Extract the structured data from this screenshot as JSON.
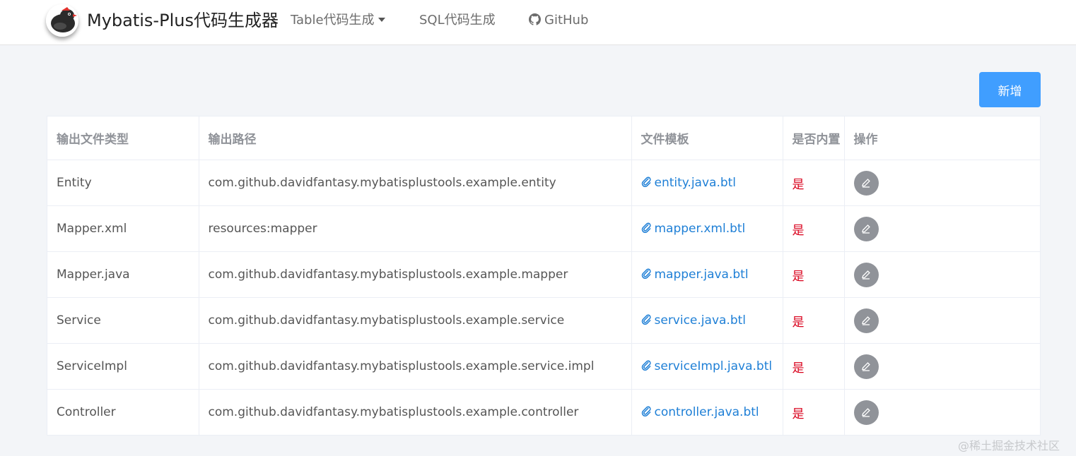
{
  "header": {
    "brand_title": "Mybatis-Plus代码生成器",
    "nav": [
      {
        "label": "Table代码生成",
        "icon": "caret-down-icon"
      },
      {
        "label": "SQL代码生成"
      },
      {
        "label": "GitHub",
        "icon": "github-icon"
      }
    ]
  },
  "toolbar": {
    "add_label": "新增",
    "accent_color": "#409eff"
  },
  "table": {
    "columns": [
      "输出文件类型",
      "输出路径",
      "文件模板",
      "是否内置",
      "操作"
    ],
    "rows": [
      {
        "type": "Entity",
        "path": "com.github.davidfantasy.mybatisplustools.example.entity",
        "template": "entity.java.btl",
        "builtin": "是"
      },
      {
        "type": "Mapper.xml",
        "path": "resources:mapper",
        "template": "mapper.xml.btl",
        "builtin": "是"
      },
      {
        "type": "Mapper.java",
        "path": "com.github.davidfantasy.mybatisplustools.example.mapper",
        "template": "mapper.java.btl",
        "builtin": "是"
      },
      {
        "type": "Service",
        "path": "com.github.davidfantasy.mybatisplustools.example.service",
        "template": "service.java.btl",
        "builtin": "是"
      },
      {
        "type": "ServiceImpl",
        "path": "com.github.davidfantasy.mybatisplustools.example.service.impl",
        "template": "serviceImpl.java.btl",
        "builtin": "是"
      },
      {
        "type": "Controller",
        "path": "com.github.davidfantasy.mybatisplustools.example.controller",
        "template": "controller.java.btl",
        "builtin": "是"
      }
    ],
    "link_color": "#1e7fd6",
    "builtin_color": "#d9001b"
  },
  "watermark": "@稀土掘金技术社区"
}
